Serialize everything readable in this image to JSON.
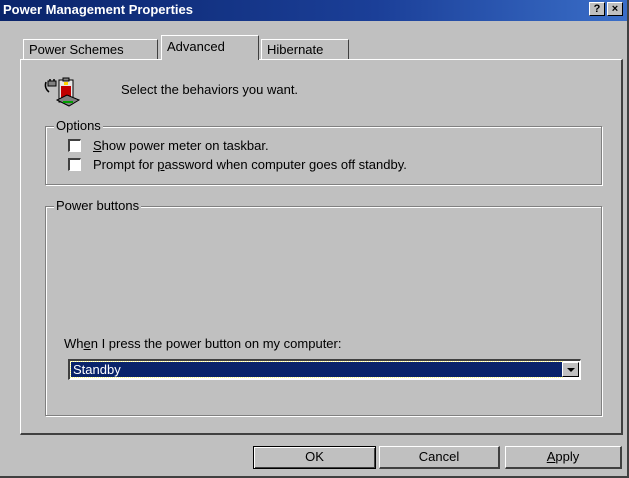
{
  "window": {
    "title": "Power Management Properties",
    "help_button": "?",
    "close_button": "×"
  },
  "tabs": [
    {
      "label": "Power Schemes",
      "selected": false
    },
    {
      "label": "Advanced",
      "selected": true
    },
    {
      "label": "Hibernate",
      "selected": false
    }
  ],
  "header": {
    "icon": "battery-plug-icon",
    "prompt": "Select the behaviors you want."
  },
  "options": {
    "label": "Options",
    "show_meter": {
      "pre": "",
      "accel": "S",
      "post": "how power meter on taskbar.",
      "checked": false
    },
    "prompt_password": {
      "pre": "Prompt for ",
      "accel": "p",
      "post": "assword when computer goes off standby.",
      "checked": false
    }
  },
  "power_buttons": {
    "label": "Power buttons",
    "when_label": {
      "pre": "Wh",
      "accel": "e",
      "post": "n I press the power button on my computer:"
    },
    "selected_value": "Standby"
  },
  "buttons": {
    "ok": "OK",
    "cancel": "Cancel",
    "apply_accel": "A",
    "apply_rest": "pply"
  }
}
